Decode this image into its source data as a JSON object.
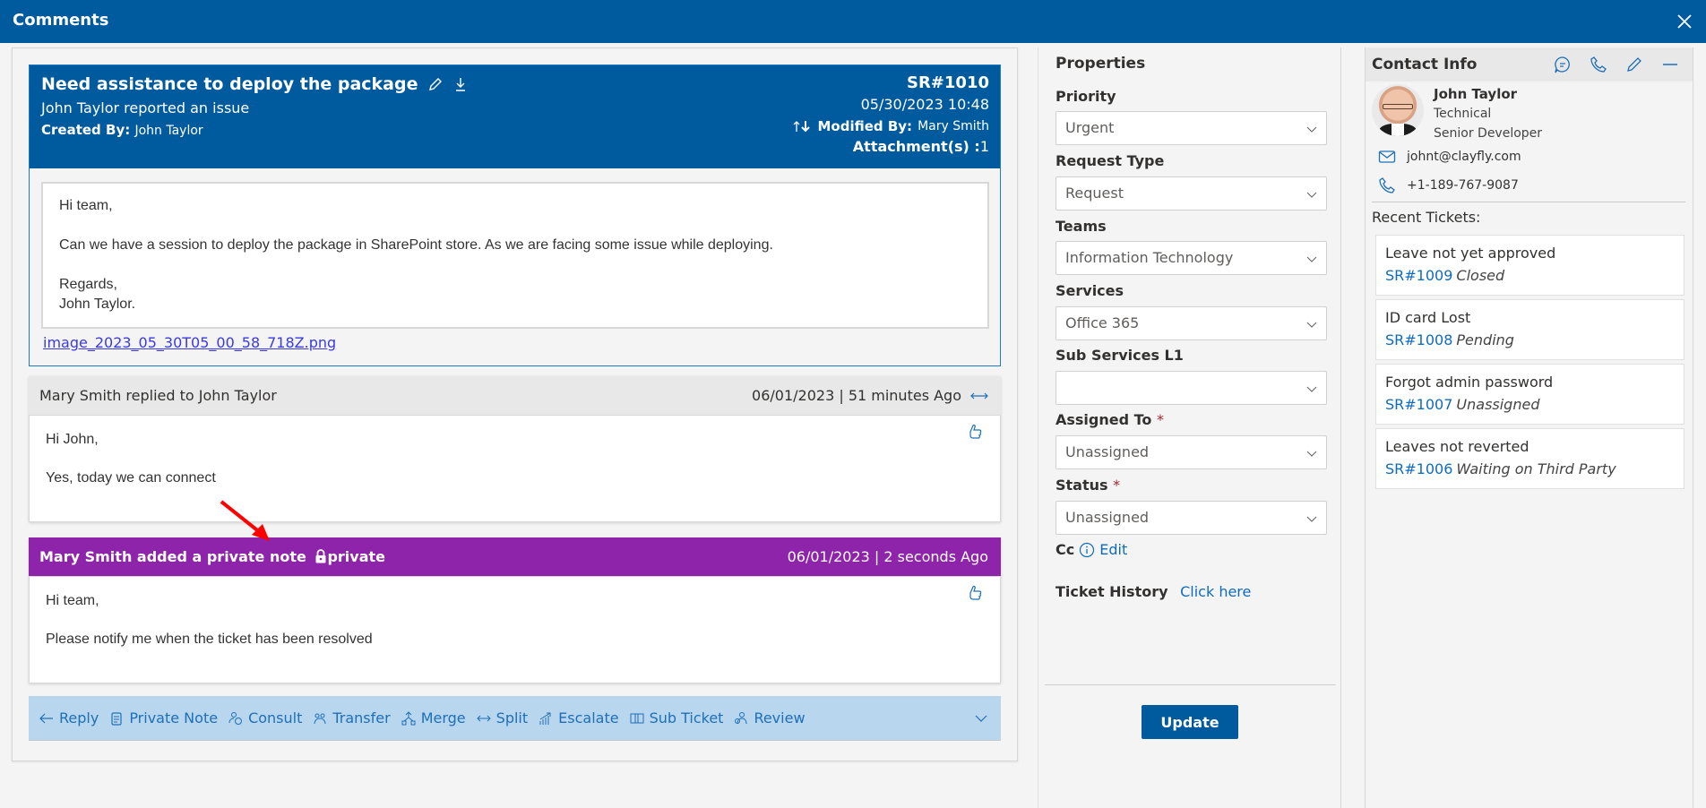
{
  "window": {
    "title": "Comments",
    "close_icon": "close-icon"
  },
  "ticket": {
    "subject": "Need assistance to deploy the package",
    "reporter_line": "John Taylor reported an issue",
    "created_by_label": "Created By:",
    "created_by": "John Taylor",
    "id": "SR#1010",
    "datetime": "05/30/2023 10:48",
    "modified_by_label": "Modified By:",
    "modified_by": "Mary Smith",
    "attachments_label": "Attachment(s) :",
    "attachments_count": "1",
    "body": {
      "greeting": "Hi team,",
      "message": "Can we have a session to deploy the package in SharePoint store. As we are facing some issue while deploying.",
      "closing": "Regards,",
      "signature": "John Taylor."
    },
    "attachment_link": "image_2023_05_30T05_00_58_718Z.png"
  },
  "comments": [
    {
      "type": "reply",
      "header": "Mary Smith replied to John Taylor",
      "meta": "06/01/2023 | 51 minutes Ago",
      "lines": [
        "Hi John,",
        "Yes, today we can connect"
      ]
    },
    {
      "type": "private",
      "header": "Mary Smith added a private note",
      "badge": "private",
      "meta": "06/01/2023 | 2 seconds Ago",
      "lines": [
        "Hi team,",
        "Please notify me when the ticket has been resolved"
      ]
    }
  ],
  "actions": [
    {
      "label": "Reply",
      "icon": "arrow-left-icon"
    },
    {
      "label": "Private Note",
      "icon": "note-icon"
    },
    {
      "label": "Consult",
      "icon": "consult-icon"
    },
    {
      "label": "Transfer",
      "icon": "transfer-icon"
    },
    {
      "label": "Merge",
      "icon": "merge-icon"
    },
    {
      "label": "Split",
      "icon": "split-icon"
    },
    {
      "label": "Escalate",
      "icon": "escalate-icon"
    },
    {
      "label": "Sub Ticket",
      "icon": "sub-ticket-icon"
    },
    {
      "label": "Review",
      "icon": "review-icon"
    }
  ],
  "properties": {
    "title": "Properties",
    "fields": [
      {
        "label": "Priority",
        "value": "Urgent",
        "required": false
      },
      {
        "label": "Request Type",
        "value": "Request",
        "required": false
      },
      {
        "label": "Teams",
        "value": "Information Technology",
        "required": false
      },
      {
        "label": "Services",
        "value": "Office 365",
        "required": false
      },
      {
        "label": "Sub Services L1",
        "value": "",
        "required": false
      },
      {
        "label": "Assigned To",
        "value": "Unassigned",
        "required": true
      },
      {
        "label": "Status",
        "value": "Unassigned",
        "required": true
      }
    ],
    "required_mark": "*",
    "cc_label": "Cc",
    "cc_edit": "Edit",
    "history_label": "Ticket History",
    "history_link": "Click here",
    "update_button": "Update"
  },
  "contact": {
    "title": "Contact Info",
    "name": "John Taylor",
    "department": "Technical",
    "role": "Senior Developer",
    "email": "johnt@clayfly.com",
    "phone": "+1-189-767-9087",
    "recent_label": "Recent Tickets:",
    "recent_tickets": [
      {
        "title": "Leave not yet approved",
        "id": "SR#1009",
        "status": "Closed"
      },
      {
        "title": "ID card Lost",
        "id": "SR#1008",
        "status": "Pending"
      },
      {
        "title": "Forgot admin password",
        "id": "SR#1007",
        "status": "Unassigned"
      },
      {
        "title": "Leaves not reverted",
        "id": "SR#1006",
        "status": "Waiting on Third Party"
      }
    ]
  },
  "colors": {
    "brand": "#005a9e",
    "private_note": "#8e24aa",
    "action_bar": "#b8d6ee",
    "link": "#0f6cbd",
    "annotation_arrow": "#ff0000"
  }
}
